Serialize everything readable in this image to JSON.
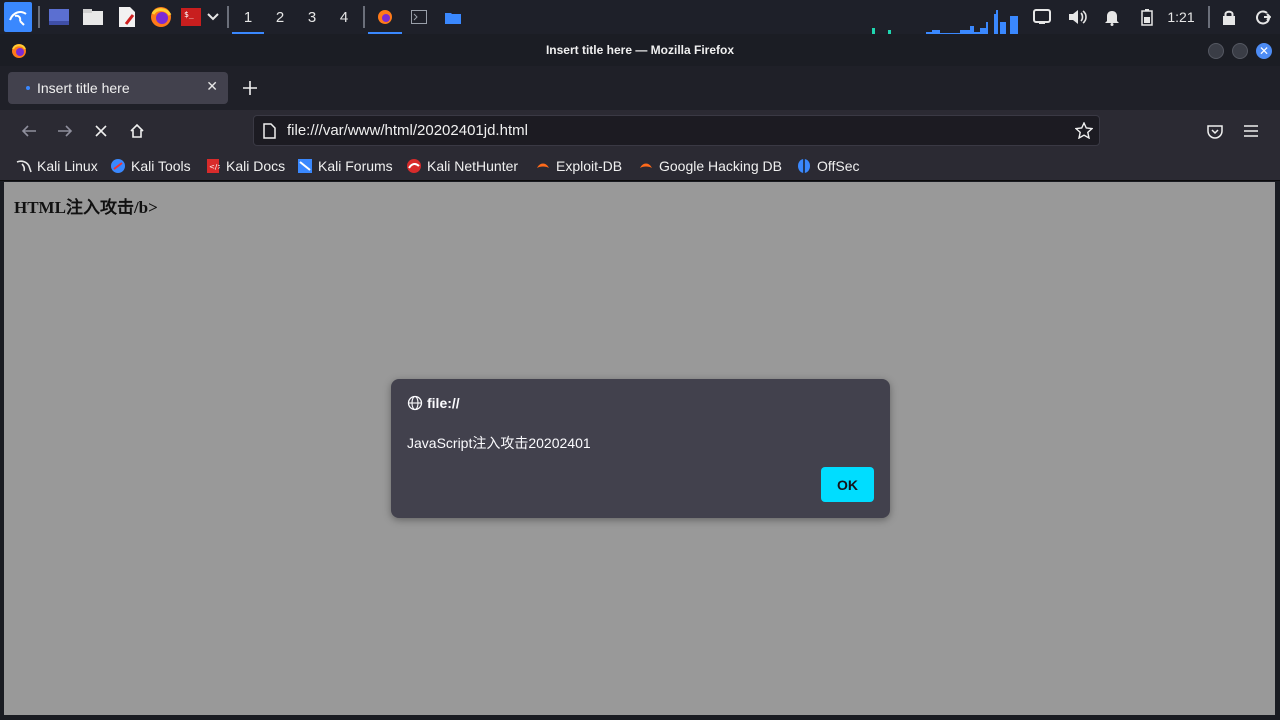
{
  "taskbar": {
    "workspaces": [
      "1",
      "2",
      "3",
      "4"
    ],
    "active_workspace": "1",
    "clock": "1:21"
  },
  "window": {
    "title": "Insert title here — Mozilla Firefox"
  },
  "tabs": [
    {
      "label": "Insert title here",
      "active": true
    }
  ],
  "navbar": {
    "url": "file:///var/www/html/20202401jd.html"
  },
  "bookmarks": [
    {
      "label": "Kali Linux",
      "icon": "kali-dragon-icon"
    },
    {
      "label": "Kali Tools",
      "icon": "kali-tools-icon"
    },
    {
      "label": "Kali Docs",
      "icon": "kali-docs-icon"
    },
    {
      "label": "Kali Forums",
      "icon": "kali-forums-icon"
    },
    {
      "label": "Kali NetHunter",
      "icon": "nethunter-icon"
    },
    {
      "label": "Exploit-DB",
      "icon": "exploit-db-icon"
    },
    {
      "label": "Google Hacking DB",
      "icon": "ghdb-icon"
    },
    {
      "label": "OffSec",
      "icon": "offsec-icon"
    }
  ],
  "page": {
    "heading": "HTML注入攻击/b>"
  },
  "dialog": {
    "origin": "file://",
    "message": "JavaScript注入攻击20202401",
    "ok_label": "OK"
  },
  "colors": {
    "accent": "#3a88fe",
    "ok_button": "#00ddff",
    "dialog_bg": "#42414d",
    "page_bg": "#999999"
  }
}
